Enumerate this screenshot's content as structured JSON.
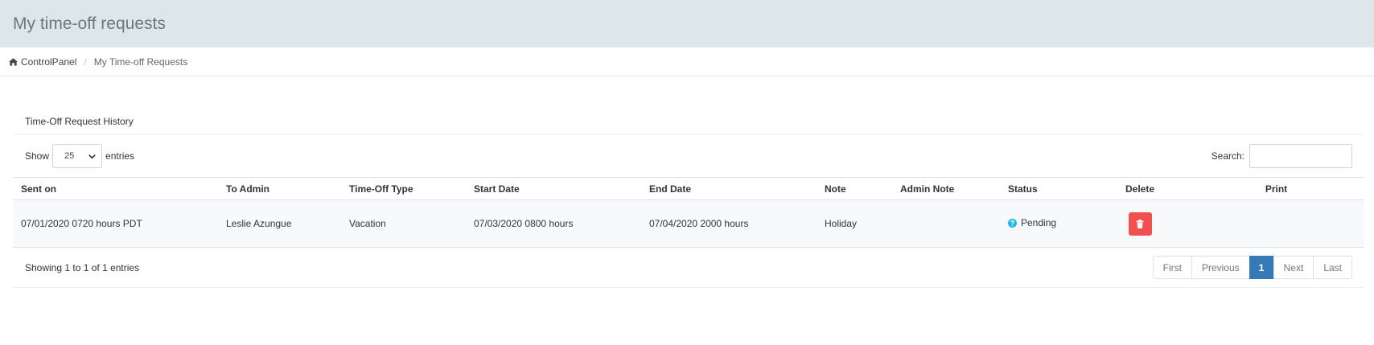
{
  "header": {
    "title": "My time-off requests"
  },
  "breadcrumb": {
    "home": "ControlPanel",
    "separator": "/",
    "current": "My Time-off Requests"
  },
  "panel": {
    "title": "Time-Off Request History"
  },
  "length": {
    "show": "Show",
    "value": "25",
    "entries": "entries"
  },
  "search": {
    "label": "Search:",
    "value": ""
  },
  "table": {
    "headers": [
      "Sent on",
      "To Admin",
      "Time-Off Type",
      "Start Date",
      "End Date",
      "Note",
      "Admin Note",
      "Status",
      "Delete",
      "Print"
    ],
    "rows": [
      {
        "sent_on": "07/01/2020 0720 hours PDT",
        "to_admin": "Leslie Azungue",
        "type": "Vacation",
        "start": "07/03/2020 0800 hours",
        "end": "07/04/2020 2000 hours",
        "note": "Holiday",
        "admin_note": "",
        "status": "Pending",
        "print": ""
      }
    ]
  },
  "info": "Showing 1 to 1 of 1 entries",
  "pagination": {
    "first": "First",
    "previous": "Previous",
    "current": "1",
    "next": "Next",
    "last": "Last"
  },
  "colors": {
    "header_bg": "#dde6e9",
    "delete_btn": "#f05050",
    "active_page": "#337ab7",
    "status_icon": "#23b7e5"
  },
  "icons": {
    "home": "home-icon",
    "select": "chevron-down-icon",
    "status": "question-circle-icon",
    "delete": "trash-icon"
  }
}
